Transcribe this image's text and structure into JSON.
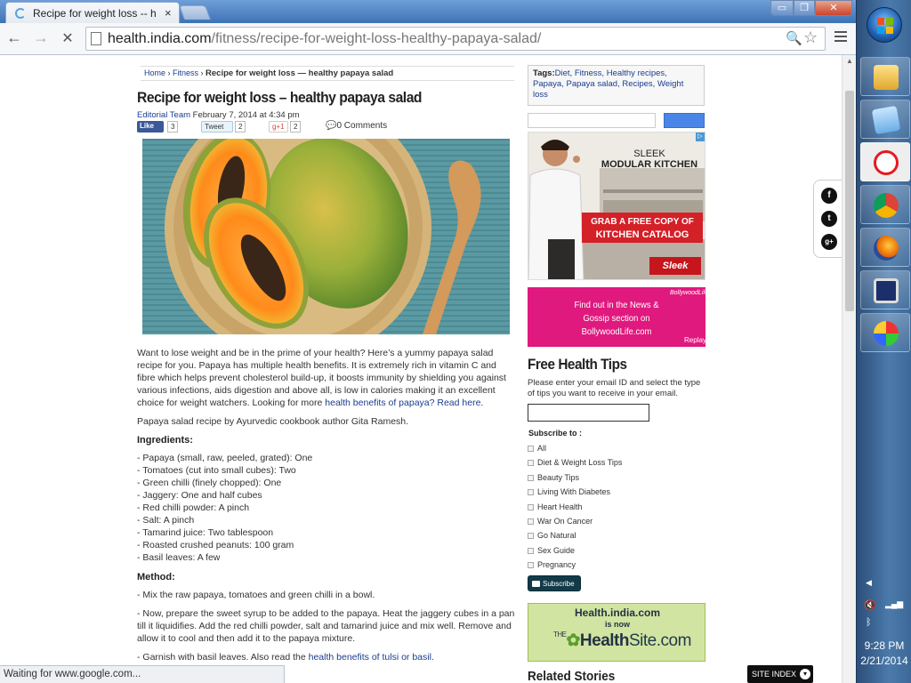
{
  "browser": {
    "tab_title": "Recipe for weight loss -- h",
    "tab_close": "×",
    "url_host": "health.india.com",
    "url_path": "/fitness/recipe-for-weight-loss-healthy-papaya-salad/",
    "status": "Waiting for www.google.com..."
  },
  "window_controls": {
    "minimize": "▭",
    "maximize": "❐",
    "close": "✕"
  },
  "nav": {
    "back": "←",
    "forward": "→",
    "stop": "✕"
  },
  "breadcrumb": {
    "home": "Home",
    "sep1": " › ",
    "section": "Fitness",
    "sep2": " › ",
    "current": "Recipe for weight loss — healthy papaya salad"
  },
  "article": {
    "title": "Recipe for weight loss – healthy papaya salad",
    "author": "Editorial Team",
    "date": " February 7, 2014 at 4:34 pm",
    "fb_like": "Like",
    "fb_count": "3",
    "tweet": "Tweet",
    "tweet_count": "2",
    "gplus": "g+1",
    "gplus_count": "2",
    "comments": "0 Comments",
    "intro": " Want to lose weight and be in the prime of your health? Here’s a yummy papaya salad recipe for you. Papaya has multiple health benefits. It is extremely rich in vitamin C and fibre which helps prevent cholesterol build-up, it boosts immunity by shielding you against various infections, aids digestion and above all, is low in calories making it an excellent choice for weight watchers. Looking for more ",
    "intro_link": "health benefits of papaya? Read here",
    "intro_end": ".",
    "credit": "Papaya salad recipe by Ayurvedic cookbook author Gita Ramesh.",
    "ingredients_heading": "Ingredients:",
    "ingredients": [
      "- Papaya (small, raw, peeled, grated): One",
      "- Tomatoes (cut into small cubes): Two",
      "- Green chilli (finely chopped): One",
      "- Jaggery: One and half cubes",
      "- Red chilli powder: A pinch",
      "- Salt: A pinch",
      "- Tamarind juice: Two tablespoon",
      "- Roasted crushed peanuts: 100 gram",
      "- Basil leaves: A few"
    ],
    "method_heading": "Method:",
    "method": [
      "- Mix the raw papaya, tomatoes and green chilli in a bowl.",
      "- Now, prepare the sweet syrup to be added to the papaya. Heat the jaggery cubes in a pan till it liquidifies. Add the red chilli powder, salt and tamarind juice and mix well. Remove and allow it to cool and then add it to the papaya mixture."
    ],
    "method_partial": "- Garnish with basil leaves. Also read the ",
    "method_link": "health benefits of tulsi or basil",
    "method_partial_end": "."
  },
  "sidebar": {
    "tags_label": "Tags:",
    "tags": "Diet, Fitness, Healthy recipes, Papaya, Papaya salad, Recipes, Weight loss",
    "ad1": {
      "line1": "SLEEK",
      "line2": "MODULAR KITCHEN",
      "cta1": "GRAB A FREE COPY OF",
      "cta2": "KITCHEN CATALOG",
      "logo": "Sleek",
      "adchoice": "▷"
    },
    "ad2": {
      "text": "Find out in the News & Gossip section on BollywoodLife.com",
      "logo": "BollywoodLife",
      "replay": "Replay"
    },
    "free_tips_heading": "Free Health Tips",
    "free_tips_desc": "Please enter your email ID and select the type of tips you want to receive in your email.",
    "subscribe_to": "Subscribe to :",
    "options": [
      "All",
      "Diet & Weight Loss Tips",
      "Beauty Tips",
      "Living With Diabetes",
      "Heart Health",
      "War On Cancer",
      "Go Natural",
      "Sex Guide",
      "Pregnancy"
    ],
    "subscribe_button": "Subscribe",
    "ad3": {
      "line1": "Health.india.com",
      "line2": "is now",
      "logo_the": "THE",
      "logo_main": "Health",
      "logo_site": "Site.com"
    },
    "related_heading": "Related Stories"
  },
  "floating_social": {
    "fb": "f",
    "tw": "t",
    "gp": "g+"
  },
  "site_index": "SITE INDEX",
  "taskbar": {
    "time": "9:28 PM",
    "date": "2/21/2014",
    "tray_up": "◀"
  }
}
